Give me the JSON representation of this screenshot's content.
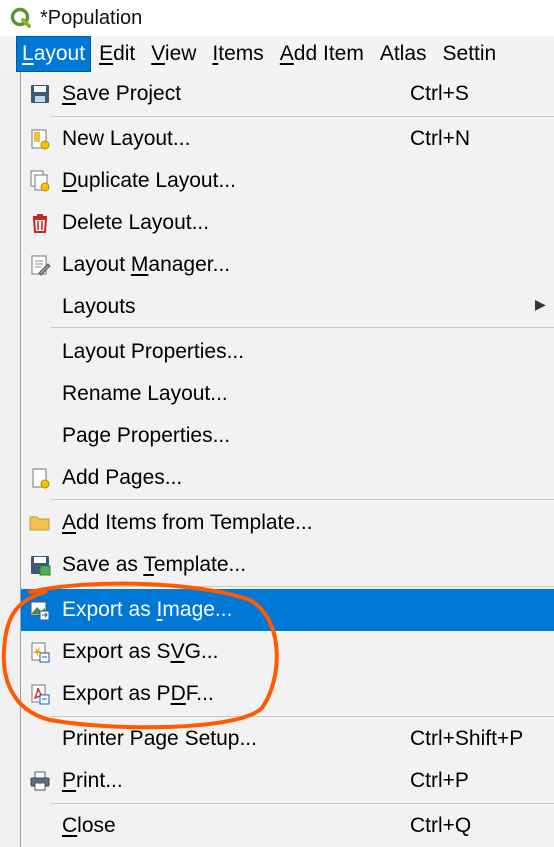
{
  "window": {
    "title": "*Population"
  },
  "menubar": {
    "items": [
      {
        "label": "Layout",
        "active": true
      },
      {
        "label": "Edit"
      },
      {
        "label": "View"
      },
      {
        "label": "Items"
      },
      {
        "label": "Add Item"
      },
      {
        "label": "Atlas"
      },
      {
        "label": "Settin"
      }
    ]
  },
  "menu": {
    "save_project": {
      "label": "Save Project",
      "shortcut": "Ctrl+S",
      "icon": "save-icon"
    },
    "new_layout": {
      "label": "New Layout...",
      "shortcut": "Ctrl+N",
      "icon": "new-layout-icon"
    },
    "duplicate_layout": {
      "label": "Duplicate Layout...",
      "icon": "duplicate-layout-icon"
    },
    "delete_layout": {
      "label": "Delete Layout...",
      "icon": "trash-icon"
    },
    "layout_manager": {
      "label": "Layout Manager...",
      "icon": "layout-manager-icon"
    },
    "layouts": {
      "label": "Layouts",
      "icon": "chevron-right-icon"
    },
    "layout_properties": {
      "label": "Layout Properties..."
    },
    "rename_layout": {
      "label": "Rename Layout..."
    },
    "page_properties": {
      "label": "Page Properties..."
    },
    "add_pages": {
      "label": "Add Pages...",
      "icon": "add-pages-icon"
    },
    "add_items_from_template": {
      "label": "Add Items from Template...",
      "icon": "folder-icon"
    },
    "save_as_template": {
      "label": "Save as Template...",
      "icon": "save-template-icon"
    },
    "export_image": {
      "label": "Export as Image...",
      "icon": "export-image-icon",
      "highlighted": true
    },
    "export_svg": {
      "label": "Export as SVG...",
      "icon": "export-svg-icon"
    },
    "export_pdf": {
      "label": "Export as PDF...",
      "icon": "export-pdf-icon"
    },
    "printer_page_setup": {
      "label": "Printer Page Setup...",
      "shortcut": "Ctrl+Shift+P"
    },
    "print": {
      "label": "Print...",
      "shortcut": "Ctrl+P",
      "icon": "printer-icon"
    },
    "close": {
      "label": "Close",
      "shortcut": "Ctrl+Q"
    }
  },
  "colors": {
    "highlight": "#0078d7",
    "annotation": "#ff5a00",
    "menu_bg": "#f2f2f2"
  }
}
